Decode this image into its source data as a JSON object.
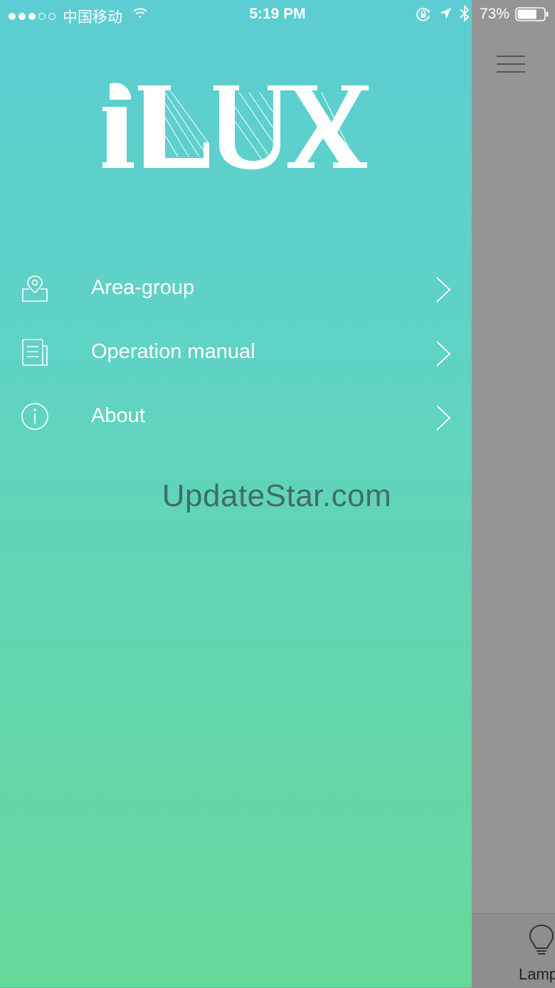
{
  "status_bar": {
    "carrier": "中国移动",
    "time": "5:19 PM",
    "battery_percent": "73%",
    "battery_level": 0.73,
    "icons": [
      "signal-dots",
      "wifi-icon",
      "rotation-lock-icon",
      "location-icon",
      "bluetooth-icon",
      "battery-icon"
    ]
  },
  "app": {
    "logo_text": "iLUX"
  },
  "menu": {
    "items": [
      {
        "label": "Area-group",
        "icon": "location-pin-icon"
      },
      {
        "label": "Operation manual",
        "icon": "document-icon"
      },
      {
        "label": "About",
        "icon": "info-icon"
      }
    ]
  },
  "watermark": "UpdateStar.com",
  "background_page": {
    "menu_icon": "hamburger-icon",
    "tab_label": "Lamp",
    "tab_icon": "lightbulb-icon"
  },
  "colors": {
    "drawer_top": "#5ccdd3",
    "drawer_bottom": "#66d89a",
    "overlay": "#959595"
  }
}
